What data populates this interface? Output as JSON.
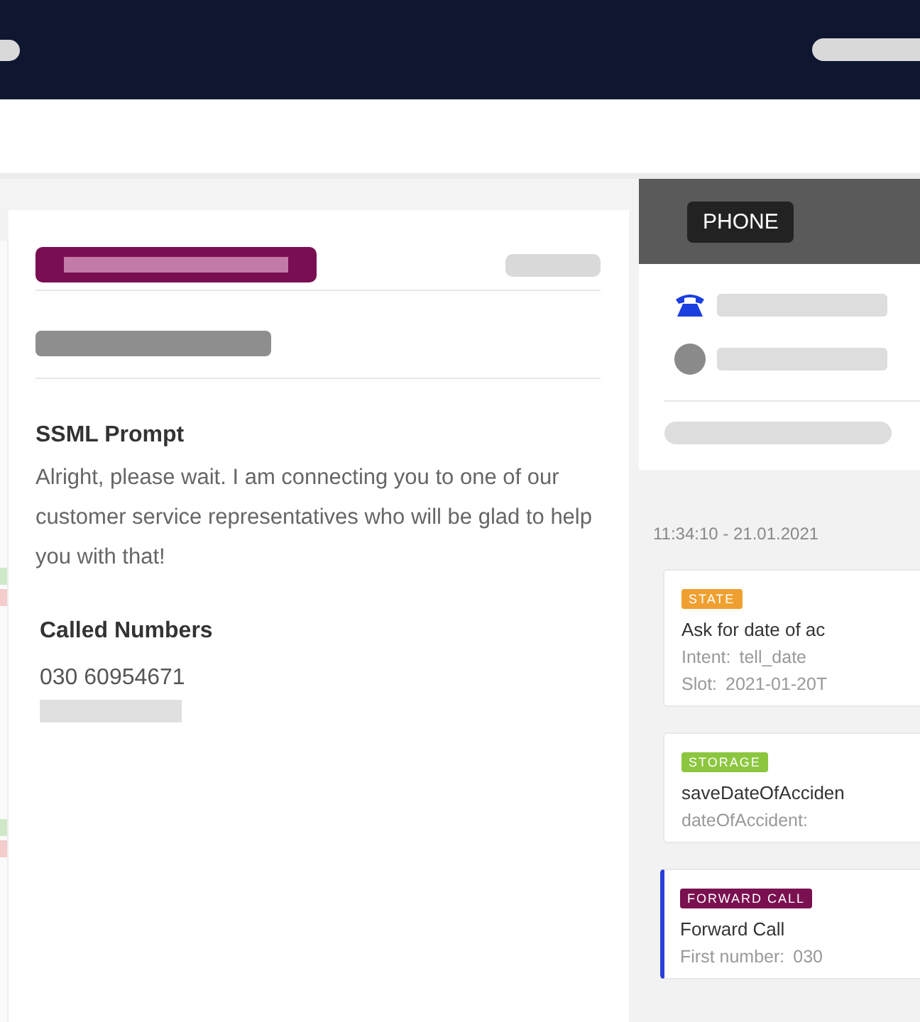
{
  "prompt": {
    "title": "SSML Prompt",
    "text": "Alright, please wait. I am connecting you to one of our customer service representatives who will be glad to help you with that!"
  },
  "called_numbers": {
    "title": "Called Numbers",
    "numbers": [
      "030 60954671"
    ]
  },
  "phone_panel": {
    "tab": "PHONE",
    "timestamp": "11:34:10 - 21.01.2021",
    "events": [
      {
        "kind": "state",
        "tag": "STATE",
        "title": "Ask for date of ac",
        "fields": [
          {
            "label": "Intent:",
            "value": "tell_date"
          },
          {
            "label": "Slot:",
            "value": "2021-01-20T"
          }
        ],
        "selected": false
      },
      {
        "kind": "storage",
        "tag": "STORAGE",
        "title": "saveDateOfAcciden",
        "fields": [
          {
            "label": "dateOfAccident:"
          }
        ],
        "selected": false
      },
      {
        "kind": "forward",
        "tag": "FORWARD CALL",
        "title": "Forward Call",
        "fields": [
          {
            "label": "First number:",
            "value": "030"
          }
        ],
        "selected": true
      }
    ]
  }
}
